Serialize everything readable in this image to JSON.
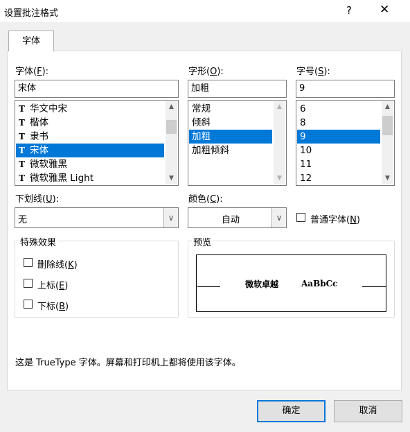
{
  "dialog": {
    "title": "设置批注格式",
    "help": "?",
    "close": "✕"
  },
  "tabs": [
    {
      "label": "字体"
    }
  ],
  "font": {
    "label": "字体(",
    "key": "F",
    "label_end": "):",
    "value": "宋体",
    "items": [
      "华文中宋",
      "楷体",
      "隶书",
      "宋体",
      "微软雅黑",
      "微软雅黑 Light"
    ],
    "selected_index": 3,
    "item_icon": "truetype-icon"
  },
  "style": {
    "label": "字形(",
    "key": "O",
    "label_end": "):",
    "value": "加粗",
    "items": [
      "常规",
      "倾斜",
      "加粗",
      "加粗倾斜"
    ],
    "selected_index": 2
  },
  "size": {
    "label": "字号(",
    "key": "S",
    "label_end": "):",
    "value": "9",
    "items": [
      "6",
      "8",
      "9",
      "10",
      "11",
      "12"
    ],
    "selected_index": 2
  },
  "underline": {
    "label": "下划线(",
    "key": "U",
    "label_end": "):",
    "value": "无"
  },
  "color": {
    "label": "颜色(",
    "key": "C",
    "label_end": "):",
    "value": "自动"
  },
  "normal_font": {
    "label": "普通字体(",
    "key": "N",
    "label_end": ")",
    "checked": false
  },
  "effects": {
    "title": "特殊效果",
    "items": [
      {
        "label": "删除线(",
        "key": "K",
        "label_end": ")",
        "checked": false
      },
      {
        "label": "上标(",
        "key": "E",
        "label_end": ")",
        "checked": false
      },
      {
        "label": "下标(",
        "key": "B",
        "label_end": ")",
        "checked": false
      }
    ]
  },
  "preview": {
    "title": "预览",
    "sample_cjk": "微软卓越",
    "sample_latin": "AaBbCc"
  },
  "info_text": "这是 TrueType 字体。屏幕和打印机上都将使用该字体。",
  "buttons": {
    "ok": "确定",
    "cancel": "取消"
  },
  "colors": {
    "selection": "#0078d7",
    "dialog_bg": "#f0f0f0"
  }
}
